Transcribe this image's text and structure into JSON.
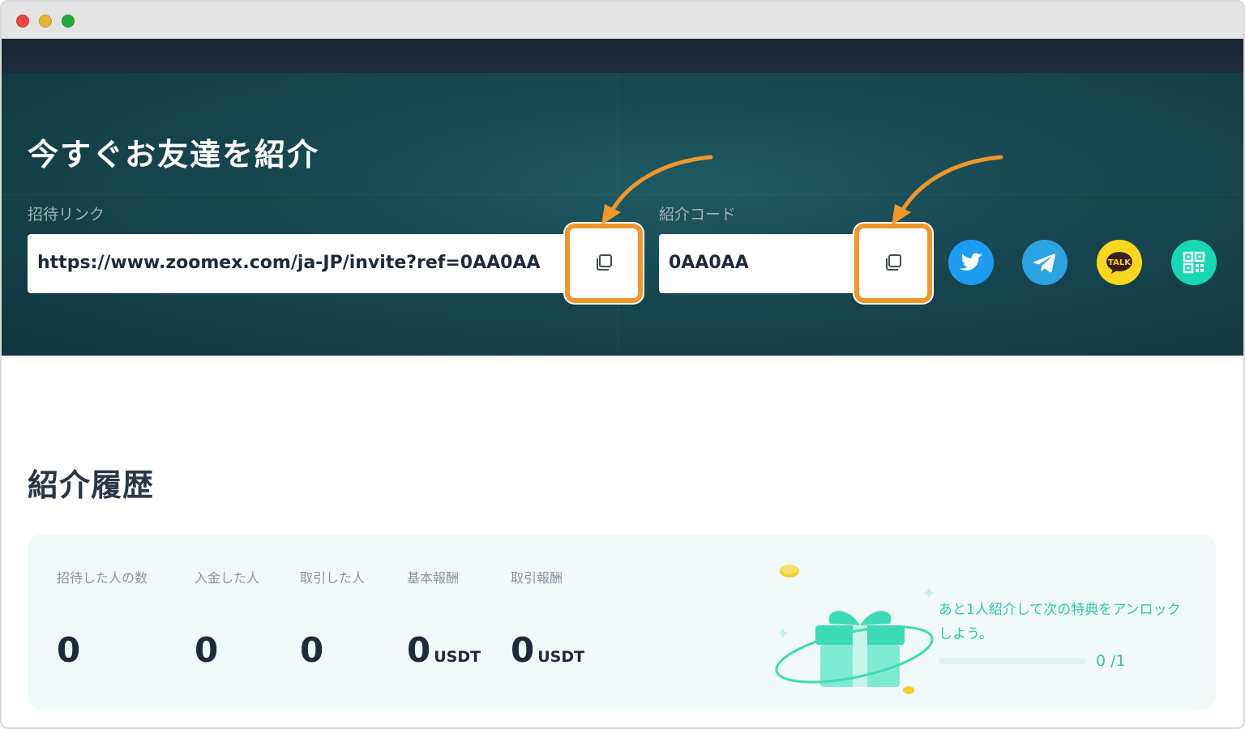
{
  "hero": {
    "title": "今すぐお友達を紹介",
    "invite_link": {
      "label": "招待リンク",
      "value": "https://www.zoomex.com/ja-JP/invite?ref=0AA0AA"
    },
    "referral_code": {
      "label": "紹介コード",
      "value": "0AA0AA"
    },
    "social": [
      "twitter-icon",
      "telegram-icon",
      "kakaotalk-icon",
      "qr-code-icon"
    ],
    "kakao_text": "TALK"
  },
  "history": {
    "title": "紹介履歴",
    "stats": [
      {
        "label": "招待した人の数",
        "value": "0",
        "unit": ""
      },
      {
        "label": "入金した人",
        "value": "0",
        "unit": ""
      },
      {
        "label": "取引した人",
        "value": "0",
        "unit": ""
      },
      {
        "label": "基本報酬",
        "value": "0",
        "unit": "USDT"
      },
      {
        "label": "取引報酬",
        "value": "0",
        "unit": "USDT"
      }
    ],
    "unlock_text": "あと1人紹介して次の特典をアンロックしよう。",
    "progress": {
      "current": 0,
      "total": 1,
      "label": "0 /1"
    }
  },
  "colors": {
    "accent": "#2cc9a8",
    "highlight": "#f0962a",
    "hero_bg": "#174650",
    "twitter": "#1d9bf0",
    "telegram": "#2aa3e0",
    "kakao": "#f9d71c",
    "qr": "#17d7b4"
  }
}
